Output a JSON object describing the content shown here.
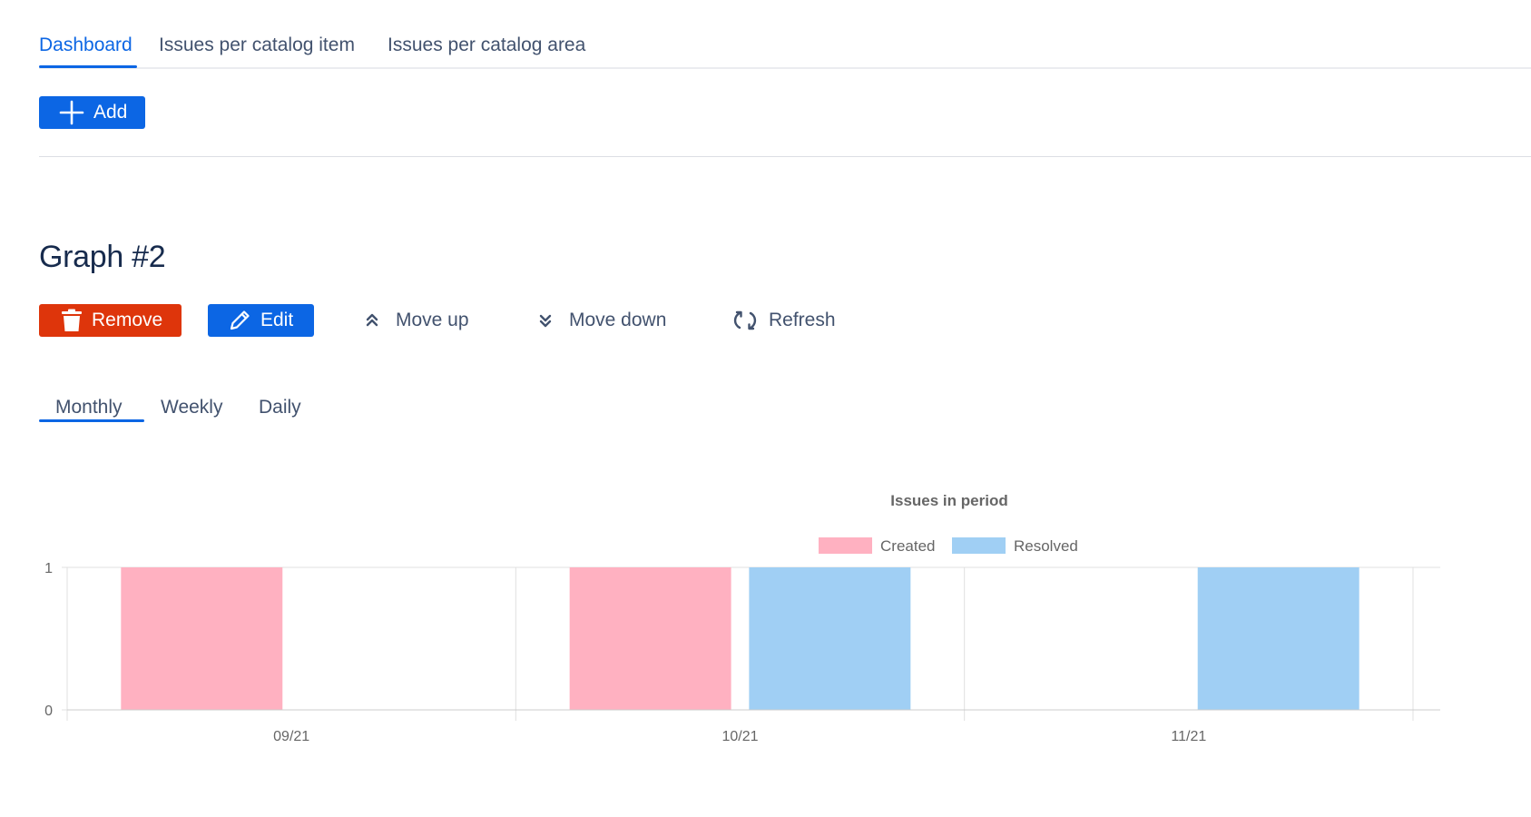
{
  "tabs": [
    {
      "label": "Dashboard",
      "active": true
    },
    {
      "label": "Issues per catalog item",
      "active": false
    },
    {
      "label": "Issues per catalog area",
      "active": false
    }
  ],
  "add_button": {
    "label": "Add",
    "icon": "plus-icon"
  },
  "graph": {
    "title": "Graph #2",
    "actions": {
      "remove": "Remove",
      "edit": "Edit",
      "move_up": "Move up",
      "move_down": "Move down",
      "refresh": "Refresh"
    },
    "period_tabs": [
      {
        "label": "Monthly",
        "active": true
      },
      {
        "label": "Weekly",
        "active": false
      },
      {
        "label": "Daily",
        "active": false
      }
    ]
  },
  "colors": {
    "primary": "#0c66e4",
    "danger": "#de350b",
    "created": "#ffb1c1",
    "resolved": "#a0cff4"
  },
  "chart_data": {
    "type": "bar",
    "title": "Issues in period",
    "categories": [
      "09/21",
      "10/21",
      "11/21"
    ],
    "series": [
      {
        "name": "Created",
        "values": [
          1,
          1,
          0
        ]
      },
      {
        "name": "Resolved",
        "values": [
          0,
          1,
          1
        ]
      }
    ],
    "ylim": [
      0,
      1
    ],
    "yticks": [
      "0",
      "1"
    ],
    "legend": "top",
    "grid": true
  }
}
